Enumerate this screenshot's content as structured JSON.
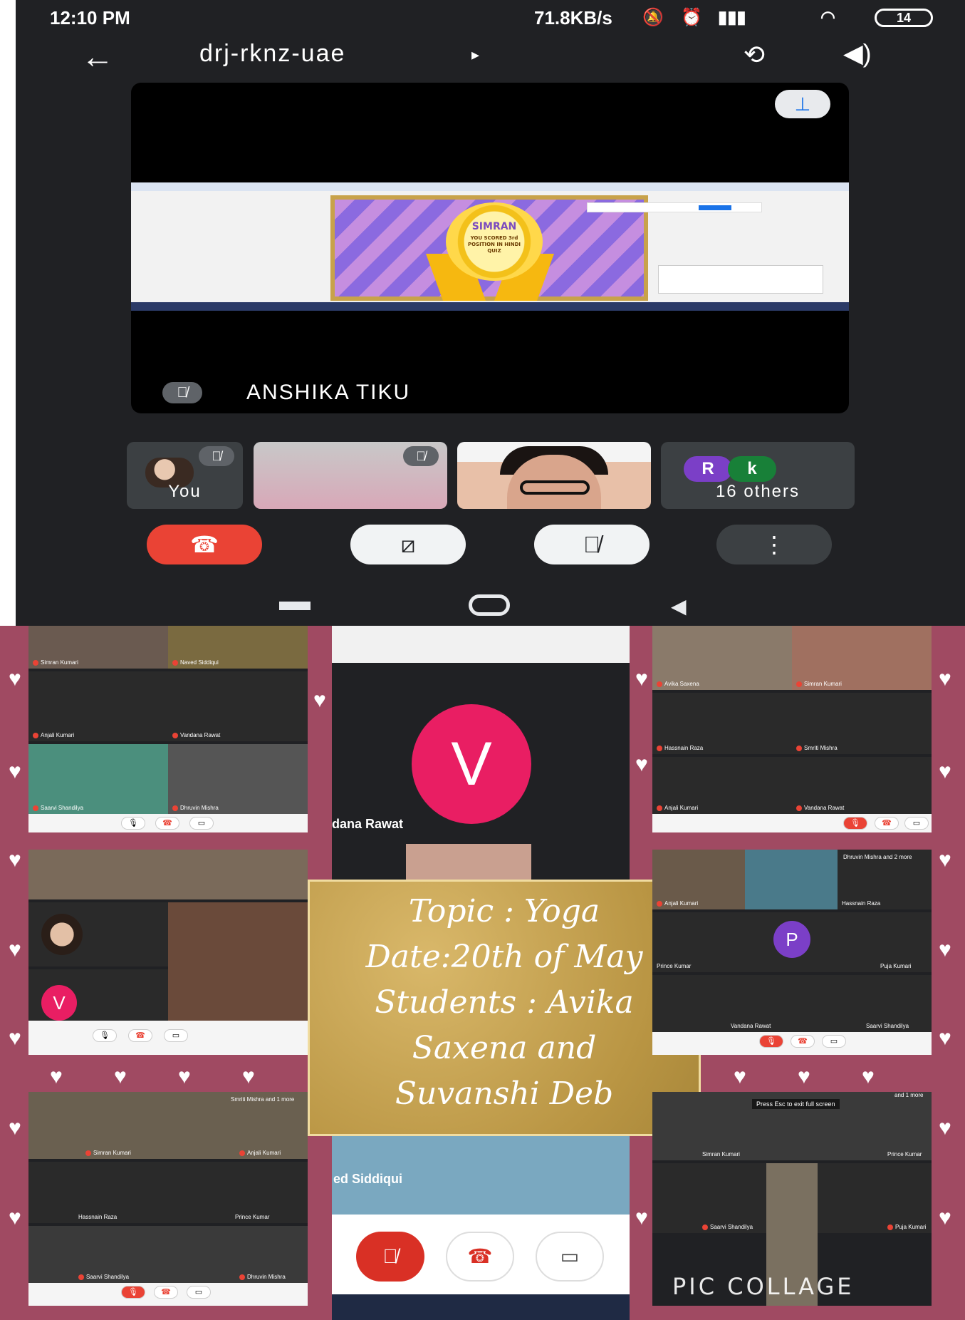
{
  "status_bar": {
    "time": "12:10 PM",
    "network_speed": "71.8KB/s",
    "battery": "14"
  },
  "call": {
    "meeting_code": "drj-rknz-uae",
    "active_speaker": "ANSHIKA TIKU",
    "award": {
      "name": "SIMRAN",
      "text": "YOU SCORED 3rd POSITION IN HINDI QUIZ"
    },
    "thumbnails": {
      "you_label": "You",
      "others_label": "16 others",
      "initials": [
        "R",
        "k"
      ]
    },
    "colors": {
      "end_call": "#ea4335",
      "initial_r": "#7b3fc7",
      "initial_k": "#188038"
    }
  },
  "collage": {
    "info_card": {
      "line1": "Topic : Yoga",
      "line2": "Date:20th of May",
      "line3": "Students : Avika",
      "line4": "Saxena and",
      "line5": "Suvanshi Deb"
    },
    "watermark": "PIC COLLAGE",
    "panel_top_left": [
      "Simran Kumari",
      "Naved Siddiqui",
      "Anjali Kumari",
      "Vandana Rawat",
      "Saarvi Shandilya",
      "Dhruvin Mishra"
    ],
    "panel_top_middle": {
      "initial": "V",
      "name": "dana Rawat"
    },
    "panel_top_right": [
      "Avika Saxena",
      "Simran Kumari",
      "Hassnain Raza",
      "Smriti Mishra",
      "Anjali Kumari",
      "Vandana Rawat"
    ],
    "panel_mid_left": {
      "initial": "V"
    },
    "panel_mid_right": {
      "labels": [
        "Dhruvin Mishra and 2 more",
        "Anjali Kumari",
        "Hassnain Raza",
        "Prince Kumar",
        "Puja Kumari",
        "Vandana Rawat",
        "Saarvi Shandilya"
      ],
      "initial": "P"
    },
    "panel_bottom_left": [
      "Smriti Mishra and 1 more",
      "Simran Kumari",
      "Anjali Kumari",
      "Hassnain Raza",
      "Prince Kumar",
      "Saarvi Shandilya",
      "Dhruvin Mishra"
    ],
    "panel_bottom_middle": {
      "name": "ed Siddiqui"
    },
    "panel_bottom_right": {
      "notice": "Press Esc to exit full screen",
      "labels": [
        "and 1 more",
        "Simran Kumari",
        "Prince Kumar",
        "Saarvi Shandilya",
        "Puja Kumari"
      ]
    }
  }
}
